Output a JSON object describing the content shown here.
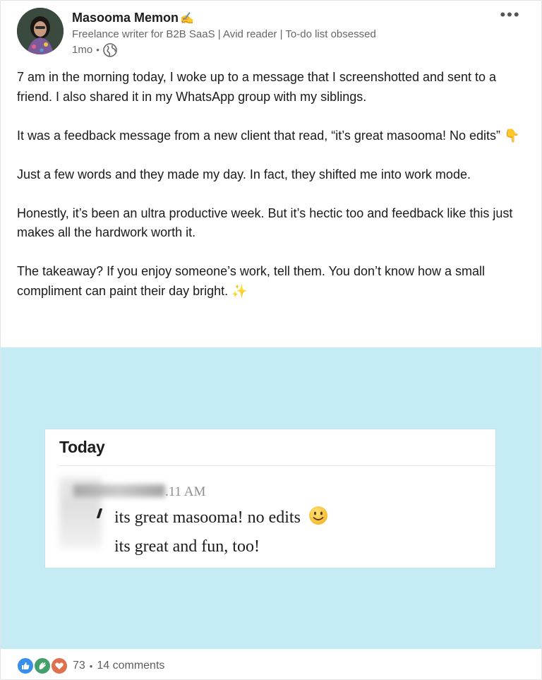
{
  "author": {
    "name": "Masooma Memon",
    "name_emoji": "✍️",
    "headline": "Freelance writer for B2B SaaS | Avid reader | To-do list obsessed",
    "time": "1mo",
    "visibility_icon": "globe-icon"
  },
  "more_menu": {
    "icon": "more-horizontal-icon",
    "label": "•••"
  },
  "post": {
    "paragraphs": [
      "7 am in the morning today, I woke up to a message that I screenshotted and sent to a friend. I also shared it in my WhatsApp group with my siblings.",
      "It was a feedback message from a new client that read, “it’s great masooma! No edits” 👇",
      "Just a few words and they made my day. In fact, they shifted me into work mode.",
      "Honestly, it’s been an ultra productive week. But it’s hectic too and feedback like this just makes all the hardwork worth it.",
      "The takeaway? If you enjoy someone’s work, tell them. You don’t know how a small compliment can paint their day bright. ✨"
    ]
  },
  "image": {
    "background": "#c5ecf4",
    "day_label": "Today",
    "time": ".11 AM",
    "messages": [
      "its great masooma! no edits",
      "its great and fun, too!"
    ],
    "message_emoji_icon": "smiley-face-icon"
  },
  "social": {
    "reactions": [
      "like-icon",
      "celebrate-icon",
      "love-icon"
    ],
    "reaction_count": "73",
    "separator": "•",
    "comments": "14 comments"
  }
}
